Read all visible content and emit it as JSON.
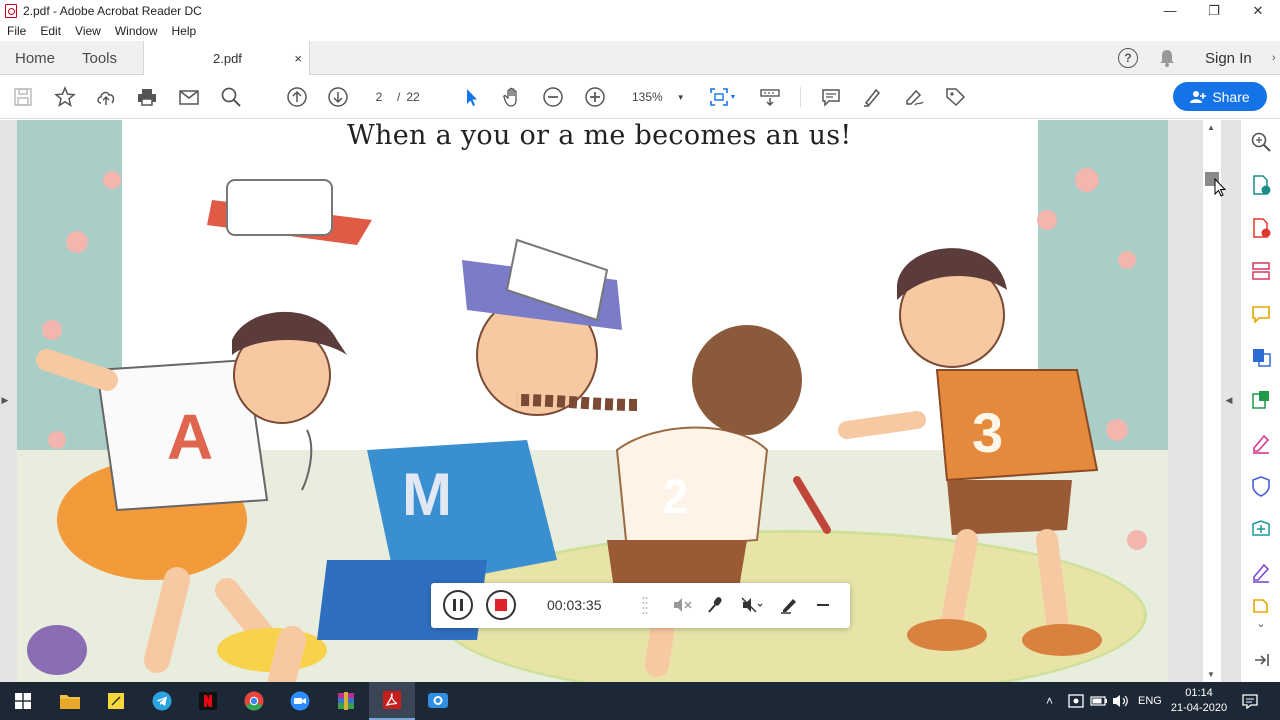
{
  "window": {
    "title": "2.pdf - Adobe Acrobat Reader DC",
    "minimize": "—",
    "restore": "❐",
    "close": "✕"
  },
  "menu": [
    "File",
    "Edit",
    "View",
    "Window",
    "Help"
  ],
  "nav": {
    "home": "Home",
    "tools": "Tools",
    "doc_tab": "2.pdf",
    "doc_tab_close": "×",
    "help": "?",
    "sign_in": "Sign In"
  },
  "toolbar": {
    "page_current": "2",
    "page_sep": "/",
    "page_total": "22",
    "zoom": "135%",
    "share": "Share"
  },
  "document": {
    "heading": "When a you or a me becomes an us!",
    "figure_labels": [
      "A",
      "M",
      "2",
      "3"
    ]
  },
  "recorder": {
    "timer": "00:03:35"
  },
  "taskbar": {
    "lang": "ENG",
    "time": "01:14",
    "date": "21-04-2020"
  },
  "colors": {
    "accent": "#1473e6",
    "acrobat_red": "#d0021b",
    "taskbar": "#1c2836"
  }
}
